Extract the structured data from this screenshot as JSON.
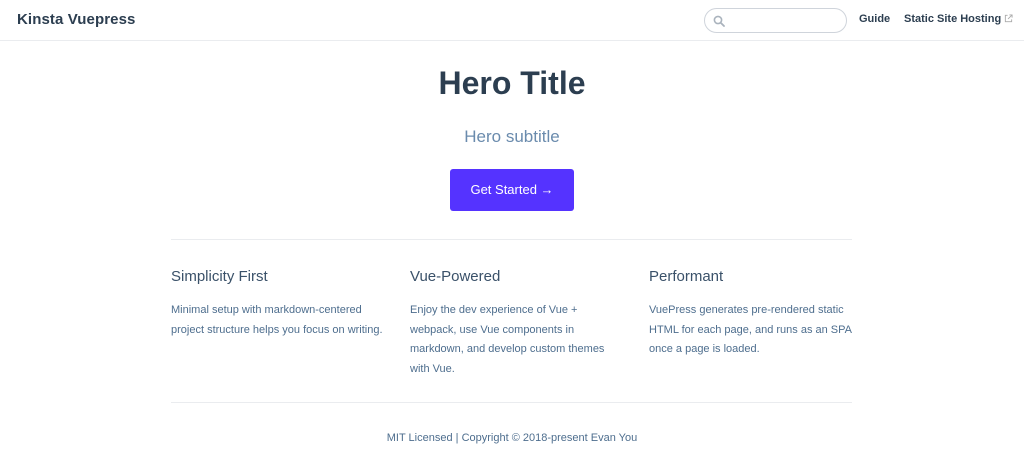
{
  "navbar": {
    "site_name": "Kinsta Vuepress",
    "search": {
      "placeholder": "",
      "value": ""
    },
    "links": [
      {
        "label": "Guide",
        "external": false
      },
      {
        "label": "Static Site Hosting",
        "external": true
      }
    ]
  },
  "hero": {
    "title": "Hero Title",
    "subtitle": "Hero subtitle",
    "action_label": "Get Started →"
  },
  "features": [
    {
      "title": "Simplicity First",
      "details": "Minimal setup with markdown-centered project structure helps you focus on writing."
    },
    {
      "title": "Vue-Powered",
      "details": "Enjoy the dev experience of Vue + webpack, use Vue components in markdown, and develop custom themes with Vue."
    },
    {
      "title": "Performant",
      "details": "VuePress generates pre-rendered static HTML for each page, and runs as an SPA once a page is loaded."
    }
  ],
  "footer": {
    "text": "MIT Licensed | Copyright © 2018-present Evan You"
  },
  "colors": {
    "accent": "#5533ff",
    "text": "#2c3e50",
    "subtitle": "#6a8bad",
    "border": "#eaecef"
  },
  "icons": {
    "search": "search-icon",
    "external": "external-link-icon"
  }
}
